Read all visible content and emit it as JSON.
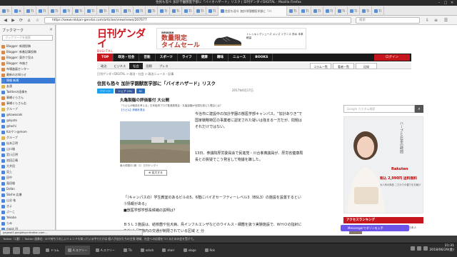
{
  "window": {
    "title": "住民も恐々 加計学園獣医学部に「バイオハザード」リスク | 日刊ゲンダイDIGITAL - Mozilla Firefox"
  },
  "tabs": [
    {
      "label": "TI"
    },
    {
      "label": "H"
    },
    {
      "label": "TI"
    },
    {
      "label": "TI"
    },
    {
      "label": "TI"
    },
    {
      "label": "TI"
    },
    {
      "label": "TI"
    },
    {
      "label": "TI"
    },
    {
      "label": "TI"
    },
    {
      "label": "TI"
    },
    {
      "label": "TI"
    },
    {
      "label": "TI"
    },
    {
      "label": "TI"
    },
    {
      "label": "TI"
    },
    {
      "label": "TI"
    },
    {
      "label": "TI"
    },
    {
      "label": "TI"
    },
    {
      "label": "TI"
    },
    {
      "label": "住民も恐々 加計学園獣医学部に「バ",
      "active": true
    },
    {
      "label": "TI"
    },
    {
      "label": "TI"
    },
    {
      "label": "TI"
    },
    {
      "label": "TI"
    },
    {
      "label": "TI"
    },
    {
      "label": "TI"
    },
    {
      "label": "TI"
    },
    {
      "label": "TI"
    }
  ],
  "nav": {
    "url": "https://www.nikkan-gendai.com/articles/view/news/207677",
    "search_placeholder": "検索"
  },
  "sidebar": {
    "title": "ブックマーク",
    "search_placeholder": "ブックマークを検索",
    "items": [
      {
        "label": "Blogger: 新規投稿",
        "icon": "orange"
      },
      {
        "label": "Blogger: 新着記事投稿",
        "icon": "orange"
      },
      {
        "label": "Blogger: 東京で見る",
        "icon": "orange"
      },
      {
        "label": "Blogger: 布施さ",
        "icon": "orange"
      },
      {
        "label": "布場進展センター",
        "icon": "orange"
      },
      {
        "label": "最新のお知らせ",
        "icon": "orange"
      },
      {
        "label": "情報 新規",
        "icon": "blue",
        "selected": true
      },
      {
        "label": "友達",
        "icon": "folder"
      },
      {
        "label": "Twitterの画像を",
        "icon": "blue"
      },
      {
        "label": "事補ぐらさん",
        "icon": "orange"
      },
      {
        "label": "事補ぐらさん右",
        "icon": "orange"
      },
      {
        "label": "グループ",
        "icon": "folder"
      },
      {
        "label": "@kawasaki",
        "icon": "blue"
      },
      {
        "label": "@kyoto",
        "icon": "blue"
      },
      {
        "label": "@tachi",
        "icon": "blue"
      },
      {
        "label": "Kのケン@mom",
        "icon": "blue"
      },
      {
        "label": "グループ",
        "icon": "folder"
      },
      {
        "label": "仙本正明",
        "icon": "blue"
      },
      {
        "label": "山口雄",
        "icon": "blue"
      },
      {
        "label": "宮川正明",
        "icon": "blue"
      },
      {
        "label": "池田正晴",
        "icon": "blue"
      },
      {
        "label": "大井田",
        "icon": "blue"
      },
      {
        "label": "見上",
        "icon": "blue"
      },
      {
        "label": "田中",
        "icon": "blue"
      },
      {
        "label": "島田雄",
        "icon": "blue"
      },
      {
        "label": "Dstbn",
        "icon": "blue"
      },
      {
        "label": "Sbshe 広瀬",
        "icon": "blue"
      },
      {
        "label": "山谷 祐",
        "icon": "blue"
      },
      {
        "label": "きよ",
        "icon": "blue"
      },
      {
        "label": "ぷーこ",
        "icon": "blue"
      },
      {
        "label": "Yokobo",
        "icon": "blue"
      },
      {
        "label": "らみ",
        "icon": "blue"
      },
      {
        "label": "mgsk 田",
        "icon": "blue"
      },
      {
        "label": "近藤 昭",
        "icon": "blue"
      }
    ]
  },
  "site": {
    "logo_main": "日刊ゲンダイ",
    "logo_sub": "DIGITAL",
    "ad": {
      "brand": "amazon",
      "headline1": "数量限定",
      "headline2": "タイムセール",
      "text": "トレッキングシューズ メンズ イグニス 防水 本革 軽量"
    },
    "menu": [
      "TOP",
      "政治・社会",
      "芸能",
      "スポーツ",
      "ライフ",
      "健康",
      "趣味",
      "ニュース",
      "BOOKS"
    ],
    "login": "ログイン",
    "submenu": [
      "政治",
      "ビジネス",
      "社会",
      "国際",
      "プレス"
    ],
    "submenu_active": "社会",
    "column_tabs": [
      "コラム一覧",
      "著者一覧",
      "記録"
    ],
    "breadcrumb": "日刊ゲンダイDIGITAL > 政治・社会 > 政治ニュース・記事",
    "headline": "住民も恐々 加計学園獣医学部に「バイオハザード」リスク",
    "share": [
      "ツイート",
      "シェア 191",
      "B!"
    ],
    "date": "2017年6月17日",
    "photo_ad": {
      "title": "丸亀製麺の評価番付 大公開",
      "line2": "「うどんが絶品を考える」日本経済プログ推進委員会・丸亀製麺が全国を超えた理由とは？",
      "link": "【うどん】評価を見る"
    },
    "caption": "最大規模の1期（C）日刊ゲンダイ",
    "zoom": "拡大する",
    "paragraphs": [
      "今治市に建設中の加計学園の獣医学部キャンパス。“加計ありき”で国家戦略特区の事業者に認定された疑いは強まる一方だが、問題はそれだけではない。",
      "13日、参議院厚労委員会で民進党・川合孝典議員が、厚労省健康局長との質疑でこう発言して物議を醸した。",
      "「（キャンパスの）学生教室のあるビルの5、6階にバイオセーフティーレベル3（BSL3）の施設を設置するという情報がある」",
      "ＢＳＬ３施設は、結核菌や狂犬病、鳥インフルエンザなどのウイルス・細菌を扱う実験施設で、ＷＨＯの指針にあれば「建物内の交通が制限されている区域 と 分"
    ],
    "subhead": "■獣医学部学部長候補の説明は？",
    "search_placeholder": "Google カスタム検索",
    "rail_ad": {
      "vertical": "ハーブとお茶の時間",
      "brand": "Rakuten",
      "price": "税込 2,990円 送料無料",
      "note": "大人気の商品 こだわりの香りをお届け"
    },
    "access_ranking": "アクセスランキング",
    "access_item": "住む場所 「生きる」の事業者が不正に日本人",
    "messenger": "Messengerでダゾンを入手"
  },
  "status_url": "pagead2.googlesyndication.com…",
  "notification": "Twitter（1番）：Twitter 画像右 · NTT持ちうれしいトレンドも知っている中でだけは 個人が自分たちの主張 地域、社会への応援をつくるための会を受けて。",
  "taskbar": {
    "tasks": [
      "ドラム",
      "A.スクリー",
      "A.スクリー",
      "Tb",
      "xcbck",
      "sharr",
      "xlogo",
      "Rok"
    ],
    "active_task": 1,
    "time": "21:31",
    "date": "2018/06/29(金)"
  }
}
